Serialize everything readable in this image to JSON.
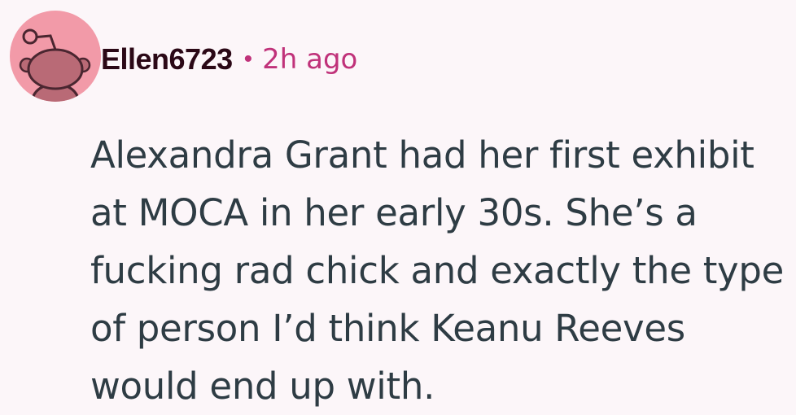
{
  "comment": {
    "username": "Ellen6723",
    "separator": "•",
    "timestamp": "2h ago",
    "body": "Alexandra Grant had her first exhibit at MOCA in her early 30s. She’s a fucking rad chick and exactly the type of person I’d think Keanu Reeves would end up with.",
    "avatar": {
      "icon": "reddit-snoo-avatar-icon",
      "background_color": "#f29aa8",
      "figure_color": "#b96a76"
    },
    "colors": {
      "username": "#2b0816",
      "timestamp": "#c0327a",
      "body_text": "#2e3c44",
      "background": "#fcf6f9"
    }
  }
}
